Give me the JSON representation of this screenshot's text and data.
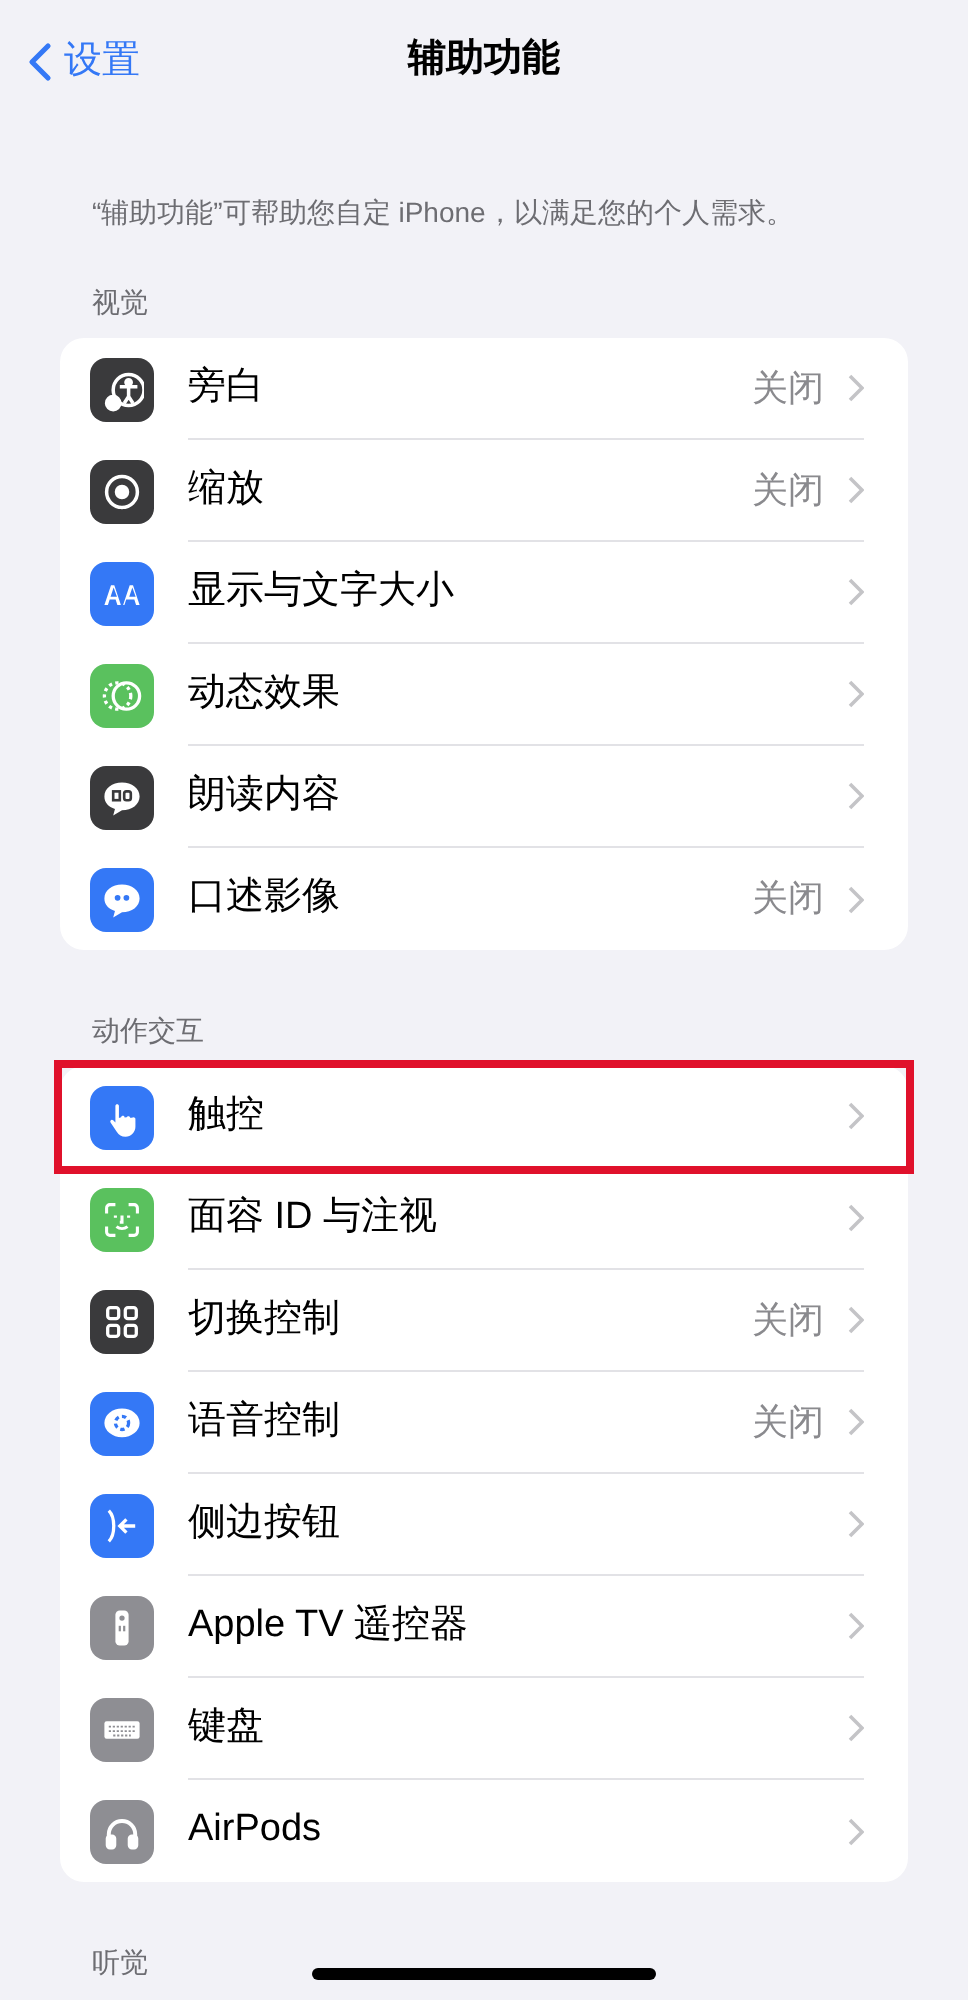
{
  "nav": {
    "back": "设置",
    "title": "辅助功能"
  },
  "description": "“辅助功能”可帮助您自定 iPhone，以满足您的个人需求。",
  "sections": [
    {
      "title": "视觉",
      "items": [
        {
          "kind": "voiceover",
          "color": "#3a3a3c",
          "label": "旁白",
          "value": "关闭",
          "highlighted": false
        },
        {
          "kind": "zoom",
          "color": "#3a3a3c",
          "label": "缩放",
          "value": "关闭",
          "highlighted": false
        },
        {
          "kind": "text-size",
          "color": "#3478f6",
          "label": "显示与文字大小",
          "highlighted": false
        },
        {
          "kind": "motion",
          "color": "#5ac15e",
          "label": "动态效果",
          "highlighted": false
        },
        {
          "kind": "speech",
          "color": "#3a3a3c",
          "label": "朗读内容",
          "highlighted": false
        },
        {
          "kind": "quote-bubble",
          "color": "#3478f6",
          "label": "口述影像",
          "value": "关闭",
          "highlighted": false
        }
      ]
    },
    {
      "title": "动作交互",
      "items": [
        {
          "kind": "hand",
          "color": "#3478f6",
          "label": "触控",
          "highlighted": true
        },
        {
          "kind": "face",
          "color": "#5ac15e",
          "label": "面容 ID 与注视",
          "highlighted": false
        },
        {
          "kind": "grid",
          "color": "#3a3a3c",
          "label": "切换控制",
          "value": "关闭",
          "highlighted": false
        },
        {
          "kind": "voice",
          "color": "#3478f6",
          "label": "语音控制",
          "value": "关闭",
          "highlighted": false
        },
        {
          "kind": "side-button",
          "color": "#3478f6",
          "label": "侧边按钮",
          "highlighted": false
        },
        {
          "kind": "remote",
          "color": "#8e8e93",
          "label": "Apple TV 遥控器",
          "highlighted": false
        },
        {
          "kind": "keyboard",
          "color": "#8e8e93",
          "label": "键盘",
          "highlighted": false
        },
        {
          "kind": "headphones",
          "color": "#8e8e93",
          "label": "AirPods",
          "highlighted": false
        }
      ]
    },
    {
      "title": "听觉"
    }
  ]
}
